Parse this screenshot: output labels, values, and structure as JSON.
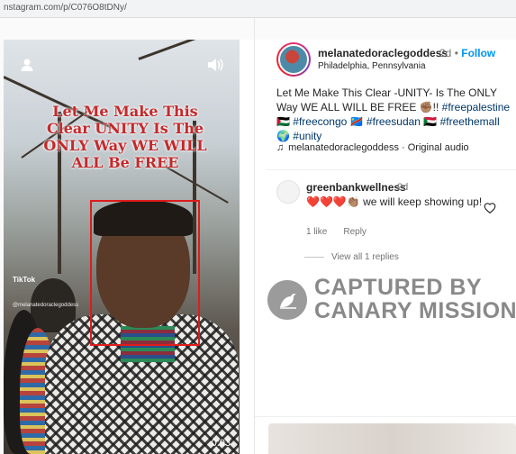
{
  "browser": {
    "url": "nstagram.com/p/C076O8tDNy/"
  },
  "video": {
    "overlay_text": "Let Me Make This Clear UNITY Is The ONLY Way WE WILL ALL Be FREE",
    "watermark_brand": "TikTok",
    "watermark_user": "@melanatedoraclegoddess",
    "timestamp": "0:03"
  },
  "post": {
    "username": "melanatedoraclegoddess",
    "age": "2d",
    "separator": "•",
    "follow_label": "Follow",
    "location": "Philadelphia, Pennsylvania",
    "caption_main": "Let Me Make This Clear -UNITY- Is The ONLY Way WE ALL WILL BE FREE ✊🏽!! ",
    "caption_tags": "#freepalestine🇵🇸 #freecongo 🇨🇩 #freesudan 🇸🇩 #freethemall 🌍 #unity",
    "audio_label": "melanatedoraclegoddess · Original audio"
  },
  "comment": {
    "username": "greenbankwellness",
    "age": "2d",
    "text": "❤️❤️❤️👏🏽 we will keep showing up!",
    "likes": "1 like",
    "reply_label": "Reply",
    "view_replies": "View all 1 replies"
  },
  "watermark": {
    "line1": "CAPTURED BY",
    "line2": "CANARY MISSION"
  },
  "colors": {
    "link": "#00376b",
    "follow": "#0095f6",
    "box": "#e01b1b",
    "headline": "#c4292b"
  }
}
